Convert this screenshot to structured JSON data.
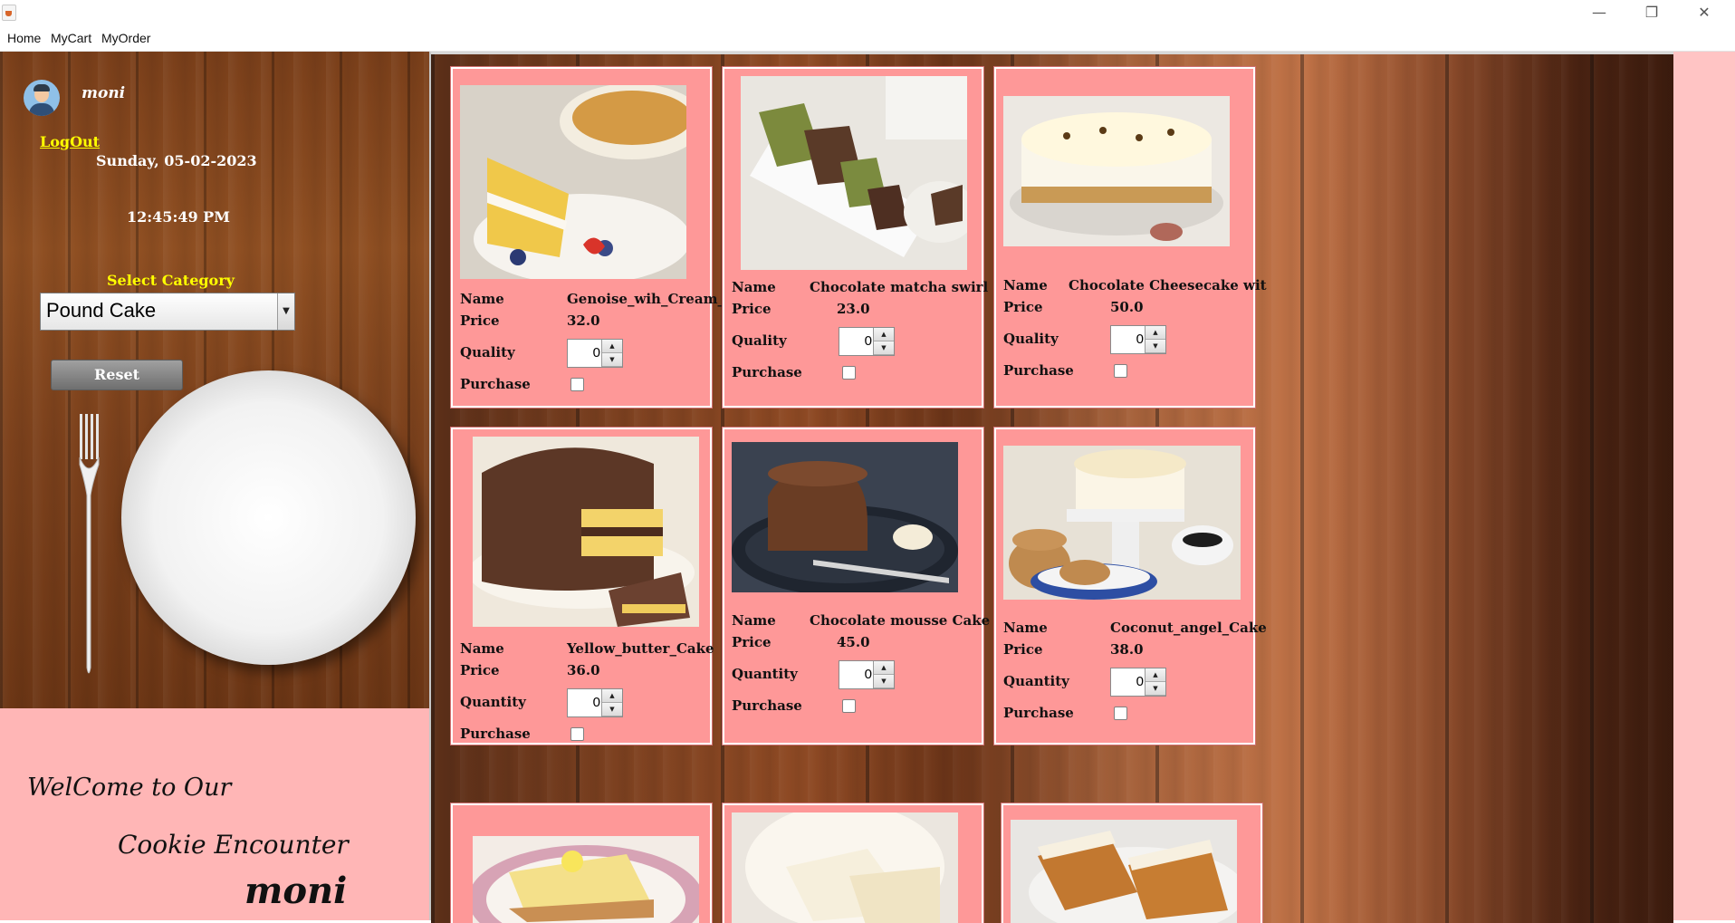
{
  "window": {
    "minimize_glyph": "—",
    "maximize_glyph": "❐",
    "close_glyph": "✕"
  },
  "menu": [
    "Home",
    "MyCart",
    "MyOrder"
  ],
  "sidebar": {
    "username": "moni",
    "logout_label": "LogOut",
    "date": "Sunday, 05-02-2023",
    "time": "12:45:49 PM",
    "select_label": "Select Category",
    "selected_category": "Pound Cake",
    "reset_label": "Reset"
  },
  "welcome": {
    "line1": "WelCome to Our",
    "line2": "Cookie Encounter",
    "user": "moni"
  },
  "field_labels": {
    "name": "Name",
    "price": "Price",
    "quality": "Quality",
    "quantity": "Quantity",
    "purchase": "Purchase"
  },
  "products": [
    {
      "name": "Genoise_wih_Cream_Cake",
      "price": "32.0",
      "qty_label": "Quality",
      "qty": "0",
      "purchased": false
    },
    {
      "name": "Chocolate matcha swirl",
      "price": "23.0",
      "qty_label": "Quality",
      "qty": "0",
      "purchased": false
    },
    {
      "name": "Chocolate Cheesecake wit",
      "price": "50.0",
      "qty_label": "Quality",
      "qty": "0",
      "purchased": false
    },
    {
      "name": "Yellow_butter_Cake",
      "price": "36.0",
      "qty_label": "Quantity",
      "qty": "0",
      "purchased": false
    },
    {
      "name": "Chocolate mousse Cake",
      "price": "45.0",
      "qty_label": "Quantity",
      "qty": "0",
      "purchased": false
    },
    {
      "name": "Coconut_angel_Cake",
      "price": "38.0",
      "qty_label": "Quantity",
      "qty": "0",
      "purchased": false
    }
  ],
  "icons": {
    "app": "java-app-icon",
    "dropdown": "chevron-down-icon",
    "avatar": "user-avatar-icon"
  }
}
